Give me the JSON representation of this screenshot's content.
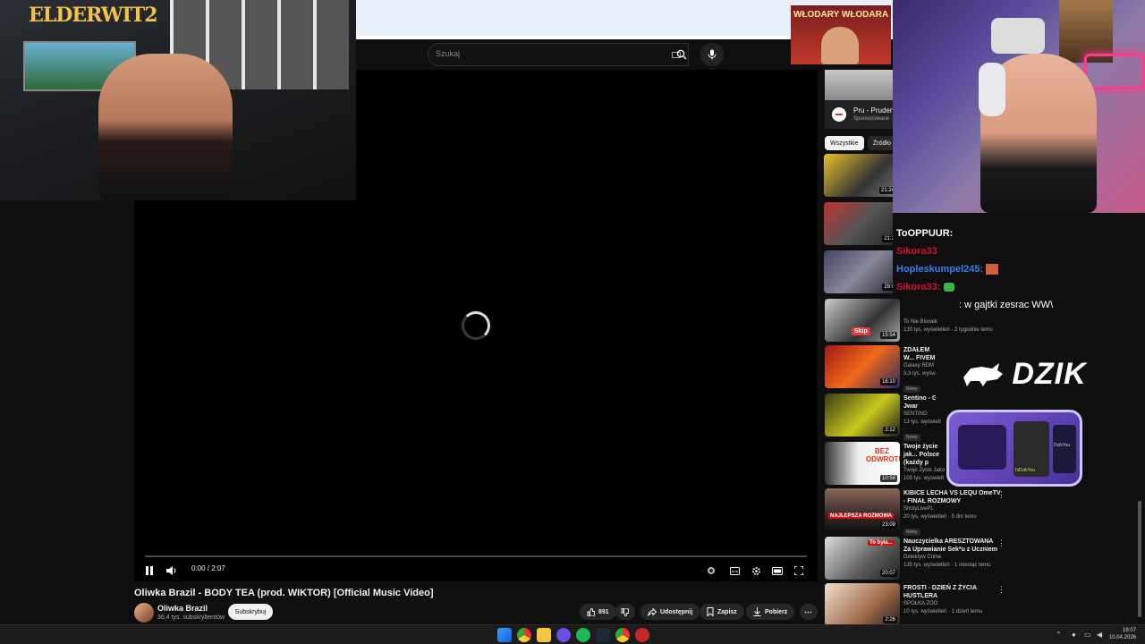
{
  "search": {
    "placeholder": "Szukaj"
  },
  "video": {
    "title": "Oliwka Brazil - BODY TEA (prod. WIKTOR) [Official Music Video]",
    "time": "0:00 / 2:07",
    "channel": "Oliwka Brazil",
    "subs": "36,4 tys. subskrybentów",
    "subscribe": "Subskrybuj",
    "likes": "891",
    "share": "Udostępnij",
    "save": "Zapisz",
    "download": "Pobierz"
  },
  "ad": {
    "title": "Pru - Pruden",
    "sponsored": "Sponsorowane ·"
  },
  "chips": [
    "Wszystkie",
    "Źródło"
  ],
  "related": [
    {
      "duration": "21:24"
    },
    {
      "duration": "21:2"
    },
    {
      "duration": "29:0"
    },
    {
      "title": "",
      "channel": "To Nie Blowek",
      "meta": "130 tys. wyświetleń · 2 tygodnie temu",
      "duration": "15:54"
    },
    {
      "title": "ZDAŁEM W... FIVEM",
      "channel": "Galaxy RDM",
      "meta": "3,3 tys. wyświ",
      "badge": "Nowy",
      "duration": "16:10"
    },
    {
      "title": "Sentino - GL... Jwar",
      "channel": "SENTINO",
      "meta": "13 tys. wyświetl",
      "badge": "Nowy",
      "duration": "2:12"
    },
    {
      "title": "Twoje życie jak... Polsce (każdy p",
      "channel": "Twoje Życie Jako",
      "meta": "103 tys. wyświetl",
      "duration": "10:58",
      "thumbText": "BEZ ODWROTU"
    },
    {
      "title": "KIBICE LECHA VS LEQU OmeTV - FINAŁ ROZMOWY",
      "channel": "ShotyLivePL",
      "meta": "20 tys. wyświetleń · 5 dni temu",
      "badge": "Nowy",
      "duration": "23:09",
      "thumbText": "NAJLEPSZA ROZMOWA"
    },
    {
      "title": "Nauczycielka ARESZTOWANA Za Uprawianie Sek*u z Uczniem",
      "channel": "Detektyw Crime",
      "meta": "135 tys. wyświetleń · 1 miesiąc temu",
      "duration": "20:07",
      "thumbText": "To była..."
    },
    {
      "title": "FROSTI - DZIEŃ Z ŻYCIA HUSTLERA",
      "channel": "SPÓŁKA ZOO",
      "meta": "10 tys. wyświetleń · 1 dzień temu",
      "duration": "2:26"
    }
  ],
  "overlay": {
    "leftLogo": "ELDERWIT2",
    "banner": "WŁODARY WŁODARA",
    "chat": [
      {
        "user": "ToOPPUUR:",
        "text": "",
        "color": "#ffffff"
      },
      {
        "user": "Sikora33",
        "text": "",
        "color": "#d0103a"
      },
      {
        "user": "Hopleskumpel245:",
        "text": "",
        "color": "#3c7df0"
      },
      {
        "user": "Sikora33:",
        "text": "",
        "color": "#d0103a"
      },
      {
        "user": "",
        "text": ": w gajtki zesrac WW\\",
        "color": "#ffffff"
      }
    ],
    "sponsor": "DZIK",
    "skip": "Skip",
    "caseLabels": [
      "hiDzikYou",
      "DzikYou"
    ]
  },
  "taskbar": {
    "time": "18:07",
    "date": "10.04.2026"
  }
}
